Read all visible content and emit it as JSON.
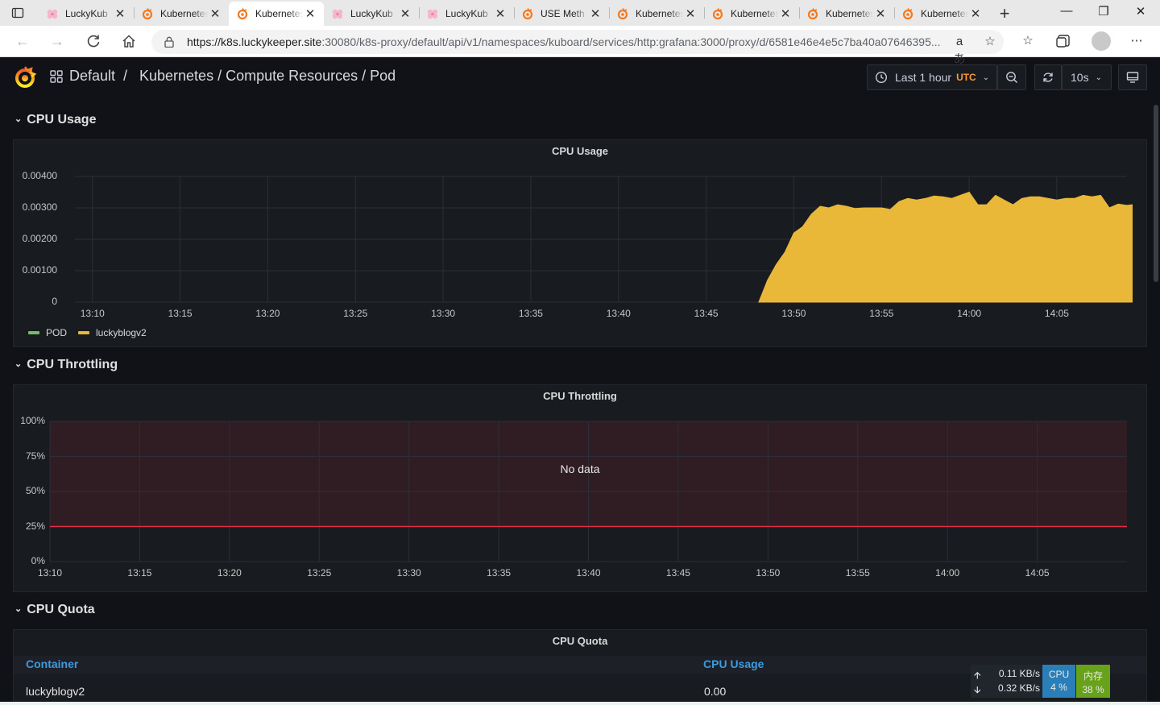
{
  "browser": {
    "tabs": [
      {
        "title": "LuckyKub",
        "icon": "lucky-favicon"
      },
      {
        "title": "Kubernetes",
        "icon": "grafana-favicon"
      },
      {
        "title": "Kubernetes",
        "icon": "grafana-favicon",
        "active": true
      },
      {
        "title": "LuckyKub",
        "icon": "lucky-favicon"
      },
      {
        "title": "LuckyKub",
        "icon": "lucky-favicon"
      },
      {
        "title": "USE Meth",
        "icon": "grafana-favicon"
      },
      {
        "title": "Kubernetes",
        "icon": "grafana-favicon"
      },
      {
        "title": "Kubernetes",
        "icon": "grafana-favicon"
      },
      {
        "title": "Kubernetes",
        "icon": "grafana-favicon"
      },
      {
        "title": "Kubernetes",
        "icon": "grafana-favicon"
      }
    ],
    "close_glyph": "✕",
    "url_host": "https://k8s.luckykeeper.site",
    "url_rest": ":30080/k8s-proxy/default/api/v1/namespaces/kuboard/services/http:grafana:3000/proxy/d/6581e46e4e5c7ba40a07646395...",
    "read_aloud_glyph": "aあ"
  },
  "grafana": {
    "breadcrumb_folder": "Default",
    "breadcrumb_sep": "/",
    "breadcrumb_dashboard": "Kubernetes / Compute Resources / Pod",
    "time_range": "Last 1 hour",
    "timezone": "UTC",
    "refresh_interval": "10s",
    "accent_color": "#f05a28"
  },
  "rows": [
    {
      "title": "CPU Usage"
    },
    {
      "title": "CPU Throttling"
    },
    {
      "title": "CPU Quota"
    }
  ],
  "panels": {
    "cpu_usage": {
      "title": "CPU Usage"
    },
    "cpu_throttling": {
      "title": "CPU Throttling",
      "no_data": "No data"
    },
    "cpu_quota": {
      "title": "CPU Quota",
      "columns": [
        "Container",
        "CPU Usage"
      ],
      "rows": [
        [
          "luckyblogv2",
          "0.00"
        ]
      ]
    }
  },
  "chart_data": [
    {
      "type": "area",
      "title": "CPU Usage",
      "x": [
        "13:10",
        "13:15",
        "13:20",
        "13:25",
        "13:30",
        "13:35",
        "13:40",
        "13:45",
        "13:50",
        "13:55",
        "14:00",
        "14:05"
      ],
      "xlim": [
        "13:09",
        "14:09"
      ],
      "ylim": [
        0,
        0.004
      ],
      "yticks": [
        "0",
        "0.00100",
        "0.00200",
        "0.00300",
        "0.00400"
      ],
      "grid": true,
      "legend_position": "bottom-left",
      "series": [
        {
          "name": "POD",
          "color": "#73bf69",
          "points": []
        },
        {
          "name": "luckyblogv2",
          "color": "#eab839",
          "points": [
            [
              "13:48",
              0
            ],
            [
              "13:48.5",
              0.0007
            ],
            [
              "13:49",
              0.0012
            ],
            [
              "13:49.5",
              0.0016
            ],
            [
              "13:50",
              0.0022
            ],
            [
              "13:50.5",
              0.0024
            ],
            [
              "13:51",
              0.0028
            ],
            [
              "13:51.5",
              0.00305
            ],
            [
              "13:52",
              0.003
            ],
            [
              "13:52.5",
              0.0031
            ],
            [
              "13:53",
              0.00305
            ],
            [
              "13:53.5",
              0.00298
            ],
            [
              "13:54",
              0.003
            ],
            [
              "13:55",
              0.003
            ],
            [
              "13:55.5",
              0.00295
            ],
            [
              "13:56",
              0.0032
            ],
            [
              "13:56.5",
              0.0033
            ],
            [
              "13:57",
              0.00325
            ],
            [
              "13:57.5",
              0.0033
            ],
            [
              "13:58",
              0.00338
            ],
            [
              "13:58.5",
              0.00335
            ],
            [
              "13:59",
              0.0033
            ],
            [
              "13:59.5",
              0.0034
            ],
            [
              "14:00",
              0.0035
            ],
            [
              "14:00.5",
              0.0031
            ],
            [
              "14:01",
              0.0031
            ],
            [
              "14:01.5",
              0.0034
            ],
            [
              "14:02",
              0.00325
            ],
            [
              "14:02.5",
              0.0031
            ],
            [
              "14:03",
              0.0033
            ],
            [
              "14:03.5",
              0.00335
            ],
            [
              "14:04",
              0.00335
            ],
            [
              "14:04.5",
              0.0033
            ],
            [
              "14:05",
              0.00325
            ],
            [
              "14:05.5",
              0.0033
            ],
            [
              "14:06",
              0.0033
            ],
            [
              "14:06.5",
              0.0034
            ],
            [
              "14:07",
              0.00335
            ],
            [
              "14:07.5",
              0.0034
            ],
            [
              "14:08",
              0.003
            ],
            [
              "14:08.5",
              0.00312
            ],
            [
              "14:09",
              0.00308
            ],
            [
              "14:09.3",
              0.0031
            ]
          ]
        }
      ]
    },
    {
      "type": "line",
      "title": "CPU Throttling",
      "x": [
        "13:10",
        "13:15",
        "13:20",
        "13:25",
        "13:30",
        "13:35",
        "13:40",
        "13:45",
        "13:50",
        "13:55",
        "14:00",
        "14:05"
      ],
      "xlim": [
        "13:10",
        "14:10"
      ],
      "ylim": [
        0,
        100
      ],
      "yticks": [
        "0%",
        "25%",
        "50%",
        "75%",
        "100%"
      ],
      "grid": true,
      "threshold": {
        "value": 25,
        "color": "#e02f44"
      },
      "series": []
    }
  ],
  "system_monitor": {
    "upload": "0.11 KB/s",
    "download": "0.32 KB/s",
    "cpu_label": "CPU",
    "cpu_value": "4 %",
    "mem_label": "内存",
    "mem_value": "38 %"
  }
}
